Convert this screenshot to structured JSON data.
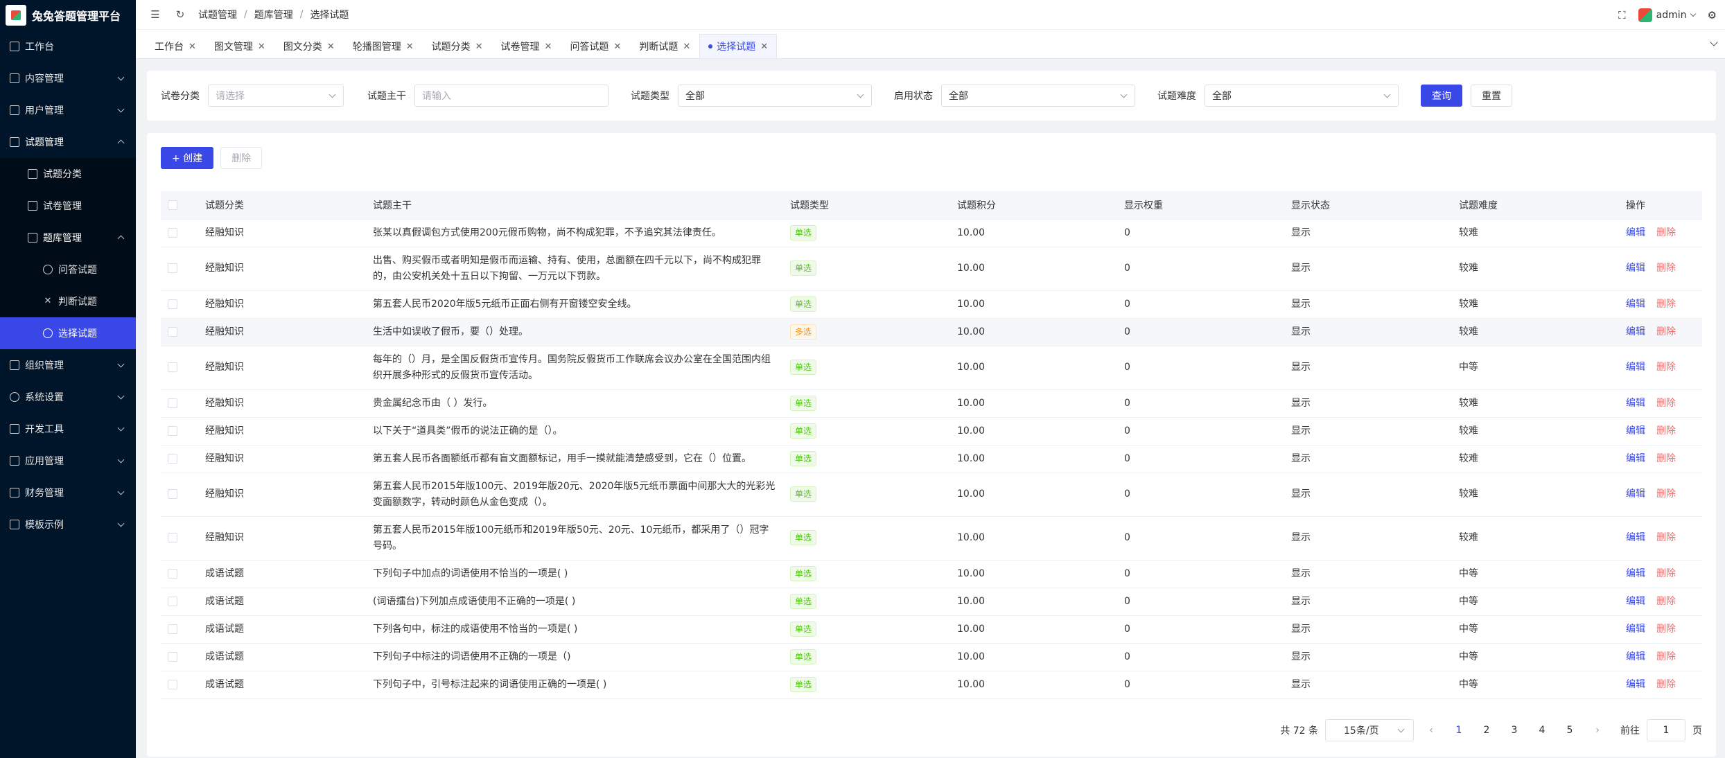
{
  "app": {
    "title": "兔兔答题管理平台"
  },
  "sidebar": {
    "items": [
      {
        "label": "工作台",
        "icon": "monitor-icon"
      },
      {
        "label": "内容管理",
        "icon": "book-icon"
      },
      {
        "label": "用户管理",
        "icon": "user-icon"
      },
      {
        "label": "试题管理",
        "icon": "edit-icon"
      },
      {
        "label": "试题分类",
        "icon": "file-icon"
      },
      {
        "label": "试卷管理",
        "icon": "document-icon"
      },
      {
        "label": "题库管理",
        "icon": "folder-icon"
      },
      {
        "label": "问答试题",
        "icon": "question-icon"
      },
      {
        "label": "判断试题",
        "icon": "cross-icon"
      },
      {
        "label": "选择试题",
        "icon": "check-circle-icon"
      },
      {
        "label": "组织管理",
        "icon": "org-icon"
      },
      {
        "label": "系统设置",
        "icon": "gear-icon"
      },
      {
        "label": "开发工具",
        "icon": "tool-icon"
      },
      {
        "label": "应用管理",
        "icon": "app-icon"
      },
      {
        "label": "财务管理",
        "icon": "chart-icon"
      },
      {
        "label": "模板示例",
        "icon": "template-icon"
      }
    ]
  },
  "header": {
    "breadcrumb": [
      "试题管理",
      "题库管理",
      "选择试题"
    ],
    "user": "admin"
  },
  "tabs": [
    "工作台",
    "图文管理",
    "图文分类",
    "轮播图管理",
    "试题分类",
    "试卷管理",
    "问答试题",
    "判断试题",
    "选择试题"
  ],
  "filter": {
    "category_label": "试卷分类",
    "category_placeholder": "请选择",
    "stem_label": "试题主干",
    "stem_placeholder": "请输入",
    "type_label": "试题类型",
    "type_value": "全部",
    "status_label": "启用状态",
    "status_value": "全部",
    "difficulty_label": "试题难度",
    "difficulty_value": "全部",
    "query_button": "查询",
    "reset_button": "重置"
  },
  "toolbar": {
    "create": "+ 创建",
    "delete": "删除"
  },
  "table": {
    "columns": [
      "试题分类",
      "试题主干",
      "试题类型",
      "试题积分",
      "显示权重",
      "显示状态",
      "试题难度",
      "操作"
    ],
    "edit_label": "编辑",
    "delete_label": "删除",
    "rows": [
      {
        "cat": "经融知识",
        "stem": "张某以真假调包方式使用200元假币购物，尚不构成犯罪，不予追究其法律责任。",
        "type": "单选",
        "score": "10.00",
        "weight": "0",
        "status": "显示",
        "diff": "较难"
      },
      {
        "cat": "经融知识",
        "stem": "出售、购买假币或者明知是假币而运输、持有、使用，总面额在四千元以下，尚不构成犯罪的，由公安机关处十五日以下拘留、一万元以下罚款。",
        "type": "单选",
        "score": "10.00",
        "weight": "0",
        "status": "显示",
        "diff": "较难"
      },
      {
        "cat": "经融知识",
        "stem": "第五套人民币2020年版5元纸币正面右侧有开窗镂空安全线。",
        "type": "单选",
        "score": "10.00",
        "weight": "0",
        "status": "显示",
        "diff": "较难"
      },
      {
        "cat": "经融知识",
        "stem": "生活中如误收了假币，要（）处理。",
        "type": "多选",
        "score": "10.00",
        "weight": "0",
        "status": "显示",
        "diff": "较难"
      },
      {
        "cat": "经融知识",
        "stem": "每年的（）月，是全国反假货币宣传月。国务院反假货币工作联席会议办公室在全国范围内组织开展多种形式的反假货币宣传活动。",
        "type": "单选",
        "score": "10.00",
        "weight": "0",
        "status": "显示",
        "diff": "中等"
      },
      {
        "cat": "经融知识",
        "stem": "贵金属纪念币由（ ）发行。",
        "type": "单选",
        "score": "10.00",
        "weight": "0",
        "status": "显示",
        "diff": "较难"
      },
      {
        "cat": "经融知识",
        "stem": "以下关于“道具类”假币的说法正确的是（）。",
        "type": "单选",
        "score": "10.00",
        "weight": "0",
        "status": "显示",
        "diff": "较难"
      },
      {
        "cat": "经融知识",
        "stem": "第五套人民币各面额纸币都有盲文面额标记，用手一摸就能清楚感受到，它在（）位置。",
        "type": "单选",
        "score": "10.00",
        "weight": "0",
        "status": "显示",
        "diff": "较难"
      },
      {
        "cat": "经融知识",
        "stem": "第五套人民币2015年版100元、2019年版20元、2020年版5元纸币票面中间那大大的光彩光变面额数字，转动时颜色从金色变成（）。",
        "type": "单选",
        "score": "10.00",
        "weight": "0",
        "status": "显示",
        "diff": "较难"
      },
      {
        "cat": "经融知识",
        "stem": "第五套人民币2015年版100元纸币和2019年版50元、20元、10元纸币，都采用了（）冠字号码。",
        "type": "单选",
        "score": "10.00",
        "weight": "0",
        "status": "显示",
        "diff": "较难"
      },
      {
        "cat": "成语试题",
        "stem": "下列句子中加点的词语使用不恰当的一项是( )",
        "type": "单选",
        "score": "10.00",
        "weight": "0",
        "status": "显示",
        "diff": "中等"
      },
      {
        "cat": "成语试题",
        "stem": "(词语擂台)下列加点成语使用不正确的一项是( )",
        "type": "单选",
        "score": "10.00",
        "weight": "0",
        "status": "显示",
        "diff": "中等"
      },
      {
        "cat": "成语试题",
        "stem": "下列各句中，标注的成语使用不恰当的一项是( )",
        "type": "单选",
        "score": "10.00",
        "weight": "0",
        "status": "显示",
        "diff": "中等"
      },
      {
        "cat": "成语试题",
        "stem": "下列句子中标注的词语使用不正确的一项是（)",
        "type": "单选",
        "score": "10.00",
        "weight": "0",
        "status": "显示",
        "diff": "中等"
      },
      {
        "cat": "成语试题",
        "stem": "下列句子中，引号标注起来的词语使用正确的一项是( )",
        "type": "单选",
        "score": "10.00",
        "weight": "0",
        "status": "显示",
        "diff": "中等"
      }
    ]
  },
  "pagination": {
    "total": "共 72 条",
    "page_size": "15条/页",
    "pages": [
      "1",
      "2",
      "3",
      "4",
      "5"
    ],
    "current": "1",
    "jump_prefix": "前往",
    "jump_value": "1",
    "jump_suffix": "页"
  }
}
